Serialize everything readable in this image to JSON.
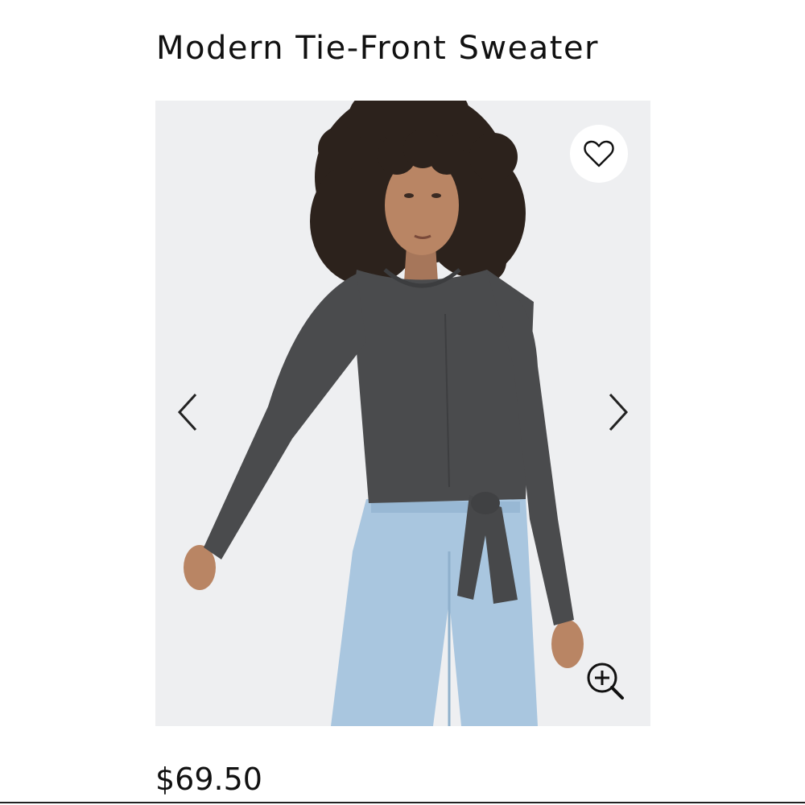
{
  "product": {
    "title": "Modern Tie-Front Sweater",
    "price": "$69.50"
  },
  "gallery": {
    "image_alt": "Model wearing a charcoal long-sleeve tie-front sweater with light-wash jeans",
    "favorite_icon": "heart-outline-icon",
    "prev_icon": "chevron-left-icon",
    "next_icon": "chevron-right-icon",
    "zoom_icon": "zoom-in-icon"
  },
  "colors": {
    "background": "#ffffff",
    "photo_background": "#eeeff1",
    "sweater": "#4a4b4d",
    "jeans": "#a9c6df",
    "text": "#111111"
  }
}
